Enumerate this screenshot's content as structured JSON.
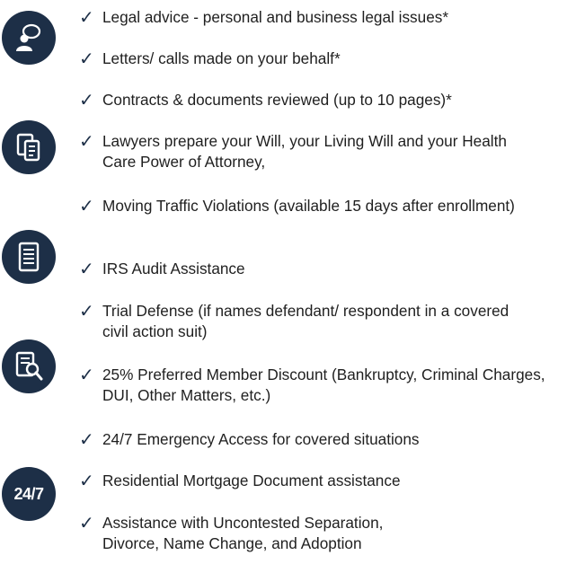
{
  "icons": [
    {
      "name": "chat-person-icon"
    },
    {
      "name": "documents-icon"
    },
    {
      "name": "document-list-icon"
    },
    {
      "name": "document-search-icon"
    },
    {
      "name": "24-7-icon",
      "text": "24/7"
    }
  ],
  "check_glyph": "✓",
  "items": [
    {
      "label": "Legal advice - personal and business legal issues*"
    },
    {
      "label": "Letters/ calls made on your behalf*"
    },
    {
      "label": "Contracts & documents reviewed (up to 10 pages)*"
    },
    {
      "label": "Lawyers prepare your Will, your Living Will and your Health Care Power of Attorney,"
    },
    {
      "label": "Moving Traffic Violations (available 15 days after enrollment)"
    },
    {
      "label": "IRS Audit Assistance"
    },
    {
      "label": "Trial Defense (if names defendant/ respondent in a covered civil action suit)"
    },
    {
      "label": "25% Preferred Member Discount (Bankruptcy, Criminal Charges, DUI, Other Matters, etc.)"
    },
    {
      "label": "24/7 Emergency Access for covered situations"
    },
    {
      "label": "Residential Mortgage Document assistance"
    },
    {
      "label": "Assistance with Uncontested Separation, Divorce, Name Change, and Adoption"
    }
  ],
  "colors": {
    "icon_bg": "#1d2f47",
    "check": "#1d2f47",
    "text": "#1f1f1f"
  }
}
